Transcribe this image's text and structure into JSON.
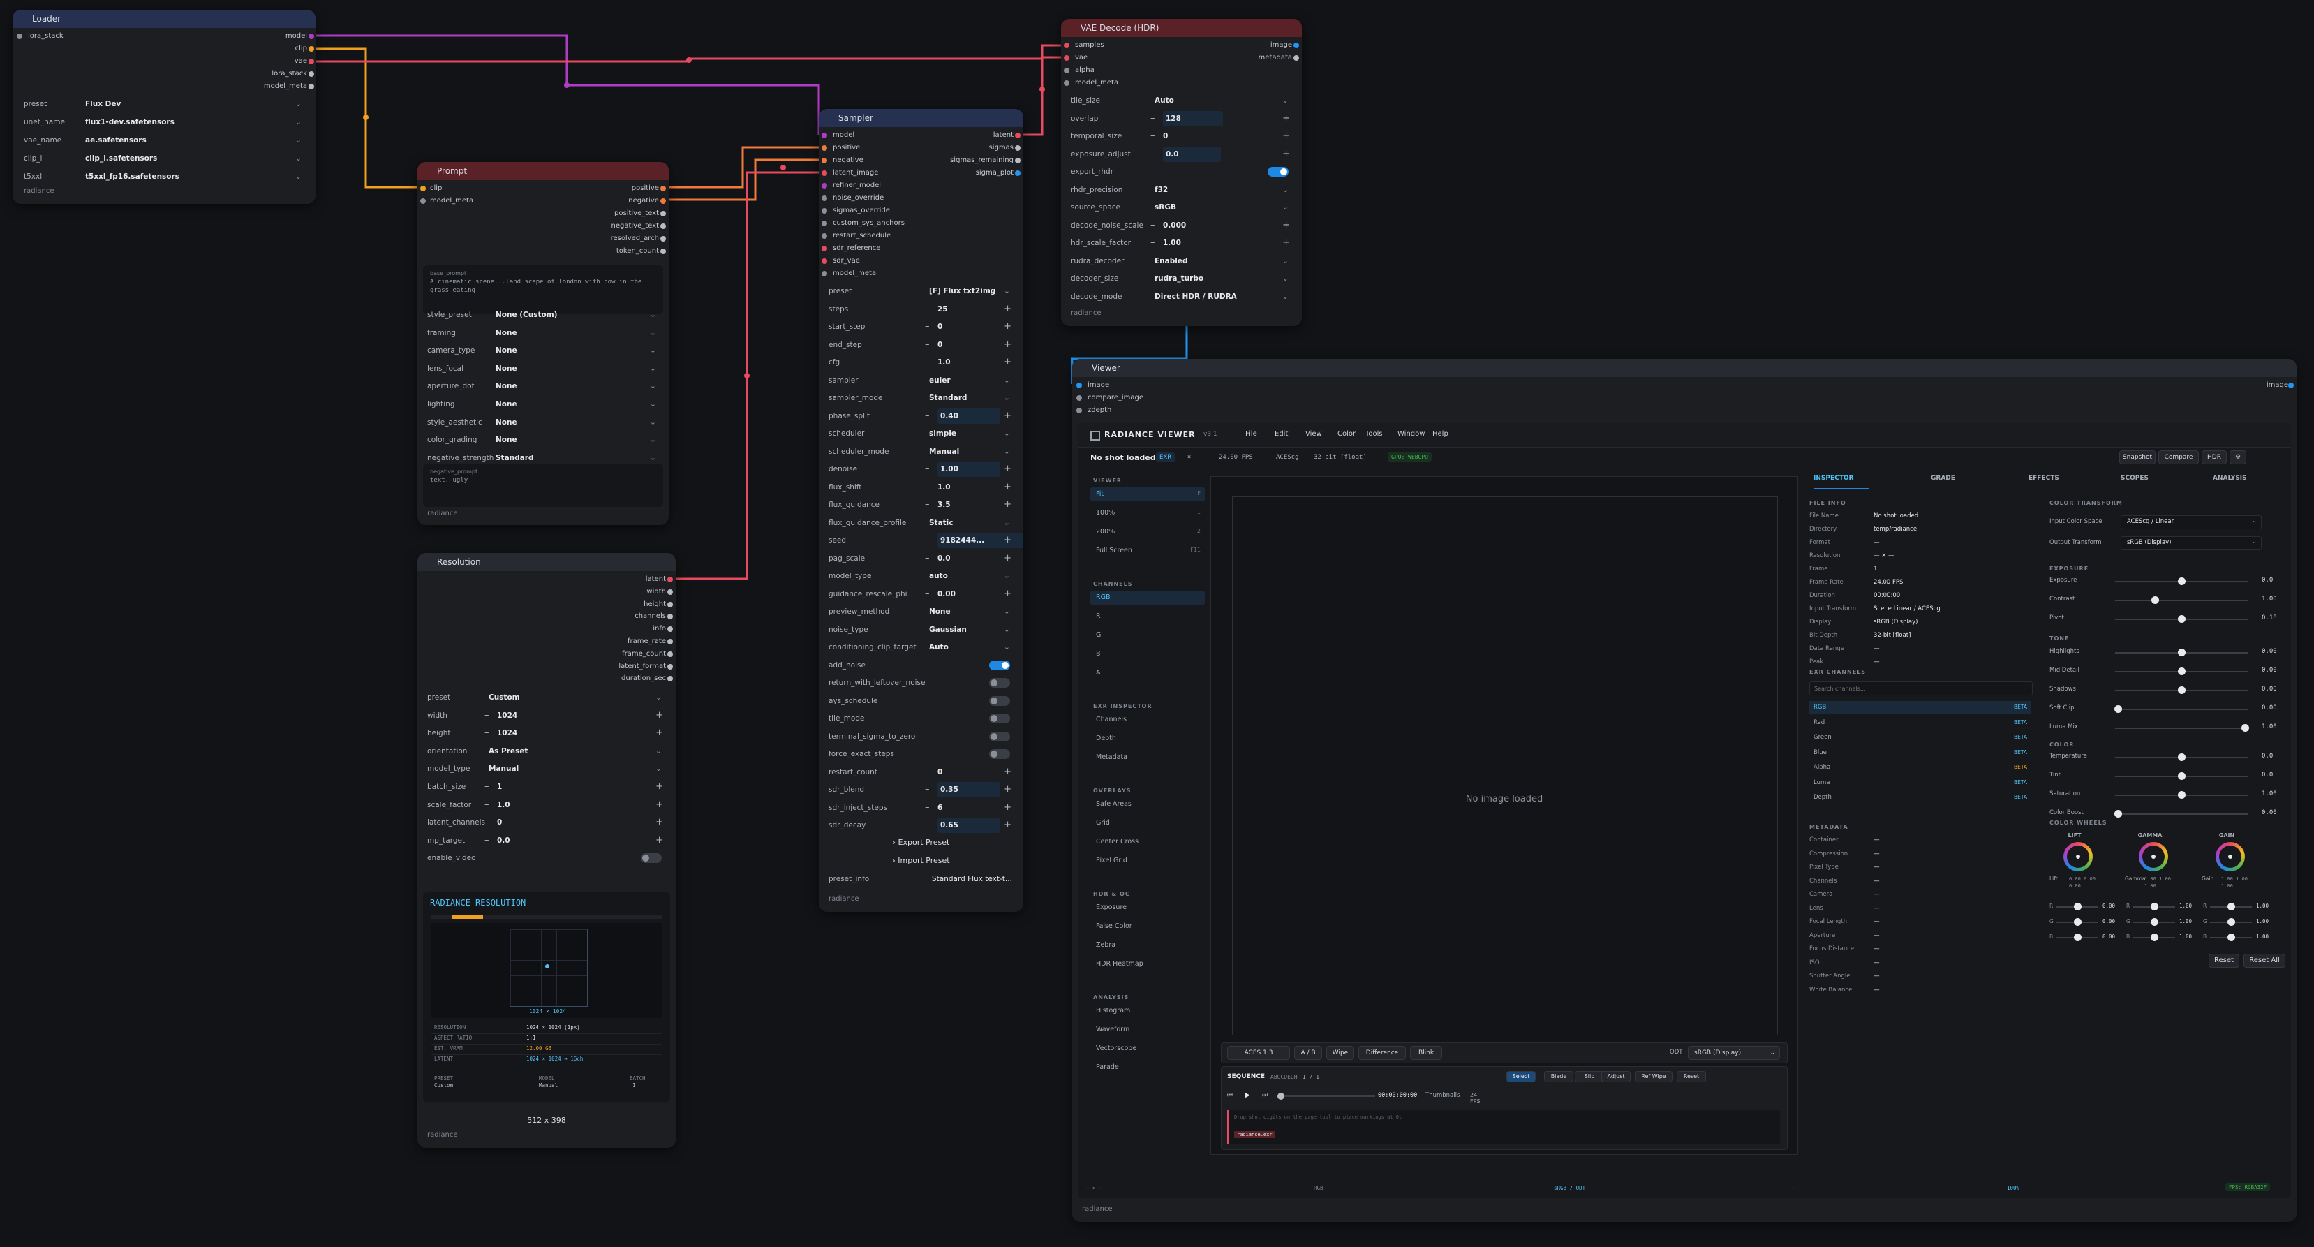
{
  "colors": {
    "accent": "#1e88e5",
    "wire_model": "#b03cc6",
    "wire_clip": "#f0a020",
    "wire_vae": "#e84a5f",
    "wire_image": "#2196f3"
  },
  "loader": {
    "title": "Loader",
    "inputs": [
      "lora_stack"
    ],
    "outputs": [
      "model",
      "clip",
      "vae",
      "lora_stack",
      "model_meta"
    ],
    "widgets": [
      {
        "label": "preset",
        "value": "Flux Dev"
      },
      {
        "label": "unet_name",
        "value": "flux1-dev.safetensors"
      },
      {
        "label": "vae_name",
        "value": "ae.safetensors"
      },
      {
        "label": "clip_l",
        "value": "clip_l.safetensors"
      },
      {
        "label": "t5xxl",
        "value": "t5xxl_fp16.safetensors"
      }
    ],
    "footer": "radiance"
  },
  "prompt": {
    "title": "Prompt",
    "inputs": [
      "clip",
      "model_meta"
    ],
    "outputs": [
      "positive",
      "negative",
      "positive_text",
      "negative_text",
      "resolved_arch",
      "token_count"
    ],
    "base_prompt_label": "base_prompt",
    "base_prompt_text": "A cinematic scene...land scape of london with cow in the grass eating",
    "widgets": [
      {
        "label": "style_preset",
        "value": "None (Custom)"
      },
      {
        "label": "framing",
        "value": "None"
      },
      {
        "label": "camera_type",
        "value": "None"
      },
      {
        "label": "lens_focal",
        "value": "None"
      },
      {
        "label": "aperture_dof",
        "value": "None"
      },
      {
        "label": "lighting",
        "value": "None"
      },
      {
        "label": "style_aesthetic",
        "value": "None"
      },
      {
        "label": "color_grading",
        "value": "None"
      },
      {
        "label": "negative_strength",
        "value": "Standard"
      }
    ],
    "negative_prompt_label": "negative_prompt",
    "negative_prompt_text": "text, ugly",
    "footer": "radiance"
  },
  "resolution": {
    "title": "Resolution",
    "outputs": [
      "latent",
      "width",
      "height",
      "channels",
      "info",
      "frame_rate",
      "frame_count",
      "latent_format",
      "duration_sec"
    ],
    "widgets": [
      {
        "label": "preset",
        "value": "Custom",
        "kind": "select"
      },
      {
        "label": "width",
        "value": "1024",
        "kind": "num"
      },
      {
        "label": "height",
        "value": "1024",
        "kind": "num"
      },
      {
        "label": "orientation",
        "value": "As Preset",
        "kind": "select"
      },
      {
        "label": "model_type",
        "value": "Manual",
        "kind": "select"
      },
      {
        "label": "batch_size",
        "value": "1",
        "kind": "num"
      },
      {
        "label": "scale_factor",
        "value": "1.0",
        "kind": "num"
      },
      {
        "label": "latent_channels",
        "value": "0",
        "kind": "num"
      },
      {
        "label": "mp_target",
        "value": "0.0",
        "kind": "num"
      },
      {
        "label": "enable_video",
        "value": "",
        "kind": "toggle"
      }
    ],
    "preview": {
      "title": "RADIANCE RESOLUTION",
      "grid_label": "1024 × 1024",
      "stats": [
        {
          "k": "RESOLUTION",
          "v": "1024 × 1024 (1px)"
        },
        {
          "k": "ASPECT RATIO",
          "v": "1:1"
        },
        {
          "k": "EST. VRAM",
          "v": "12.00 GB"
        },
        {
          "k": "LATENT",
          "v": "1024 × 1024 → 16ch"
        }
      ],
      "preset_label": "PRESET",
      "preset_value": "Custom",
      "model_label": "MODEL",
      "model_value": "Manual",
      "batch_label": "BATCH",
      "batch_value": "1",
      "size": "512 x 398"
    },
    "footer": "radiance"
  },
  "sampler": {
    "title": "Sampler",
    "inputs": [
      "model",
      "positive",
      "negative",
      "latent_image",
      "refiner_model",
      "noise_override",
      "sigmas_override",
      "custom_sys_anchors",
      "restart_schedule",
      "sdr_reference",
      "sdr_vae",
      "model_meta"
    ],
    "outputs": [
      "latent",
      "sigmas",
      "sigmas_remaining",
      "sigma_plot"
    ],
    "widgets": [
      {
        "label": "preset",
        "value": "[F] Flux txt2img",
        "kind": "select"
      },
      {
        "label": "steps",
        "value": "25",
        "kind": "num"
      },
      {
        "label": "start_step",
        "value": "0",
        "kind": "num"
      },
      {
        "label": "end_step",
        "value": "0",
        "kind": "num"
      },
      {
        "label": "cfg",
        "value": "1.0",
        "kind": "num"
      },
      {
        "label": "sampler",
        "value": "euler",
        "kind": "select"
      },
      {
        "label": "sampler_mode",
        "value": "Standard",
        "kind": "select"
      },
      {
        "label": "phase_split",
        "value": "0.40",
        "kind": "num",
        "hl": true
      },
      {
        "label": "scheduler",
        "value": "simple",
        "kind": "select"
      },
      {
        "label": "scheduler_mode",
        "value": "Manual",
        "kind": "select"
      },
      {
        "label": "denoise",
        "value": "1.00",
        "kind": "num",
        "hl": true
      },
      {
        "label": "flux_shift",
        "value": "1.0",
        "kind": "num"
      },
      {
        "label": "flux_guidance",
        "value": "3.5",
        "kind": "num"
      },
      {
        "label": "flux_guidance_profile",
        "value": "Static",
        "kind": "select"
      },
      {
        "label": "seed",
        "value": "9182444...",
        "kind": "num",
        "hl": true
      },
      {
        "label": "pag_scale",
        "value": "0.0",
        "kind": "num"
      },
      {
        "label": "model_type",
        "value": "auto",
        "kind": "select"
      },
      {
        "label": "guidance_rescale_phi",
        "value": "0.00",
        "kind": "num"
      },
      {
        "label": "preview_method",
        "value": "None",
        "kind": "select"
      },
      {
        "label": "noise_type",
        "value": "Gaussian",
        "kind": "select"
      },
      {
        "label": "conditioning_clip_target",
        "value": "Auto",
        "kind": "select"
      },
      {
        "label": "add_noise",
        "value": "",
        "kind": "toggle_on"
      },
      {
        "label": "return_with_leftover_noise",
        "value": "",
        "kind": "toggle"
      },
      {
        "label": "ays_schedule",
        "value": "",
        "kind": "toggle"
      },
      {
        "label": "tile_mode",
        "value": "",
        "kind": "toggle"
      },
      {
        "label": "terminal_sigma_to_zero",
        "value": "",
        "kind": "toggle"
      },
      {
        "label": "force_exact_steps",
        "value": "",
        "kind": "toggle"
      },
      {
        "label": "restart_count",
        "value": "0",
        "kind": "num"
      },
      {
        "label": "sdr_blend",
        "value": "0.35",
        "kind": "num",
        "hl": true
      },
      {
        "label": "sdr_inject_steps",
        "value": "6",
        "kind": "num"
      },
      {
        "label": "sdr_decay",
        "value": "0.65",
        "kind": "num",
        "hl": true
      }
    ],
    "export_preset": "› Export Preset",
    "import_preset": "› Import Preset",
    "preset_info_label": "preset_info",
    "preset_info_value": "Standard Flux text-t...",
    "footer": "radiance"
  },
  "vae": {
    "title": "VAE Decode (HDR)",
    "inputs": [
      "samples",
      "vae",
      "alpha",
      "model_meta"
    ],
    "outputs": [
      "image",
      "metadata"
    ],
    "widgets": [
      {
        "label": "tile_size",
        "value": "Auto",
        "kind": "select"
      },
      {
        "label": "overlap",
        "value": "128",
        "kind": "num",
        "hl": true
      },
      {
        "label": "temporal_size",
        "value": "0",
        "kind": "num"
      },
      {
        "label": "exposure_adjust",
        "value": "0.0",
        "kind": "num",
        "hl": true
      },
      {
        "label": "export_rhdr",
        "value": "",
        "kind": "toggle_on"
      },
      {
        "label": "rhdr_precision",
        "value": "f32",
        "kind": "select"
      },
      {
        "label": "source_space",
        "value": "sRGB",
        "kind": "select"
      },
      {
        "label": "decode_noise_scale",
        "value": "0.000",
        "kind": "num"
      },
      {
        "label": "hdr_scale_factor",
        "value": "1.00",
        "kind": "num"
      },
      {
        "label": "rudra_decoder",
        "value": "Enabled",
        "kind": "select"
      },
      {
        "label": "decoder_size",
        "value": "rudra_turbo",
        "kind": "select"
      },
      {
        "label": "decode_mode",
        "value": "Direct HDR / RUDRA",
        "kind": "select"
      }
    ],
    "footer": "radiance"
  },
  "viewer": {
    "title": "Viewer",
    "inputs": [
      "image",
      "compare_image",
      "zdepth"
    ],
    "output": "image",
    "footer": "radiance",
    "app": {
      "name": "RADIANCE VIEWER",
      "version": "v3.1",
      "menu": [
        "File",
        "Edit",
        "View",
        "Color",
        "Tools",
        "Window",
        "Help"
      ],
      "shot": "No shot loaded",
      "exr_badge": "EXR",
      "dims": "— × —",
      "fps": "24.00 FPS",
      "cs": "ACEScg",
      "bits": "32-bit [float]",
      "gpu": "GPU: WEBGPU",
      "top_buttons": [
        "Snapshot",
        "Compare",
        "HDR",
        "⚙"
      ],
      "sidebar": [
        {
          "head": "VIEWER",
          "items": [
            "Fit",
            "100%",
            "200%",
            "Full Screen"
          ]
        },
        {
          "head": "CHANNELS",
          "items": [
            "RGB",
            "R",
            "G",
            "B",
            "A"
          ]
        },
        {
          "head": "EXR INSPECTOR",
          "items": [
            "Channels",
            "Depth",
            "Metadata"
          ]
        },
        {
          "head": "OVERLAYS",
          "items": [
            "Safe Areas",
            "Grid",
            "Center Cross",
            "Pixel Grid"
          ]
        },
        {
          "head": "HDR & QC",
          "items": [
            "Exposure",
            "False Color",
            "Zebra",
            "HDR Heatmap"
          ]
        },
        {
          "head": "ANALYSIS",
          "items": [
            "Histogram",
            "Waveform",
            "Vectorscope",
            "Parade"
          ]
        }
      ],
      "sidebar_keys": [
        "F",
        "1",
        "2",
        "F11"
      ],
      "no_image": "No image loaded",
      "compare_controls": [
        "ACES 1.3",
        "A / B",
        "Wipe",
        "Difference",
        "Blink"
      ],
      "odt_label": "ODT",
      "odt_value": "sRGB (Display)",
      "sequence_label": "SEQUENCE",
      "sequence_sub": "ABOCDEGH",
      "sequence_count": "1 / 1",
      "seq_tools": [
        "Select",
        "Blade",
        "Slip",
        "Adjust",
        "Ref Wipe",
        "Reset"
      ],
      "timecode": "00:00:00:00",
      "thumbnails": "Thumbnails",
      "fps_small": "24 FPS",
      "drop_hint": "Drop shot digits on the page tool to place markings at 0t",
      "track_label": "radiance.exr",
      "tabs": [
        "INSPECTOR",
        "GRADE",
        "EFFECTS",
        "SCOPES",
        "ANALYSIS"
      ],
      "file_info_head": "FILE INFO",
      "file_info": [
        {
          "k": "File Name",
          "v": "No shot loaded"
        },
        {
          "k": "Directory",
          "v": "temp/radiance"
        },
        {
          "k": "Format",
          "v": "—"
        },
        {
          "k": "Resolution",
          "v": "— × —"
        },
        {
          "k": "Frame",
          "v": "1"
        },
        {
          "k": "Frame Rate",
          "v": "24.00 FPS"
        },
        {
          "k": "Duration",
          "v": "00:00:00"
        },
        {
          "k": "Input Transform",
          "v": "Scene Linear / ACEScg"
        },
        {
          "k": "Display",
          "v": "sRGB (Display)"
        },
        {
          "k": "Bit Depth",
          "v": "32-bit [float]"
        },
        {
          "k": "Data Range",
          "v": "—"
        },
        {
          "k": "Peak",
          "v": "—"
        }
      ],
      "exr_channels_head": "EXR CHANNELS",
      "search_placeholder": "Search channels...",
      "channels": [
        {
          "name": "RGB",
          "tag": "BETA"
        },
        {
          "name": "Red",
          "tag": "BETA"
        },
        {
          "name": "Green",
          "tag": "BETA"
        },
        {
          "name": "Blue",
          "tag": "BETA"
        },
        {
          "name": "Alpha",
          "tag": "BETA"
        },
        {
          "name": "Luma",
          "tag": "BETA"
        },
        {
          "name": "Depth",
          "tag": "BETA"
        }
      ],
      "metadata_head": "METADATA",
      "metadata": [
        "Container",
        "Compression",
        "Pixel Type",
        "Channels",
        "Camera",
        "Lens",
        "Focal Length",
        "Aperture",
        "Focus Distance",
        "ISO",
        "Shutter Angle",
        "White Balance"
      ],
      "metadata_value": "—",
      "color_transform_head": "COLOR TRANSFORM",
      "input_cs_label": "Input Color Space",
      "input_cs_value": "ACEScg / Linear",
      "output_tf_label": "Output Transform",
      "output_tf_value": "sRGB (Display)",
      "exposure_head": "EXPOSURE",
      "exposure": [
        {
          "k": "Exposure",
          "v": "0.0",
          "pos": 0.5
        },
        {
          "k": "Contrast",
          "v": "1.00",
          "pos": 0.3
        },
        {
          "k": "Pivot",
          "v": "0.18",
          "pos": 0.5
        }
      ],
      "tone_head": "TONE",
      "tone": [
        {
          "k": "Highlights",
          "v": "0.00",
          "pos": 0.5
        },
        {
          "k": "Mid Detail",
          "v": "0.00",
          "pos": 0.5
        },
        {
          "k": "Shadows",
          "v": "0.00",
          "pos": 0.5
        },
        {
          "k": "Soft Clip",
          "v": "0.00",
          "pos": 0.02
        },
        {
          "k": "Luma Mix",
          "v": "1.00",
          "pos": 0.98
        }
      ],
      "color_head": "COLOR",
      "color": [
        {
          "k": "Temperature",
          "v": "0.0",
          "pos": 0.5
        },
        {
          "k": "Tint",
          "v": "0.0",
          "pos": 0.5
        },
        {
          "k": "Saturation",
          "v": "1.00",
          "pos": 0.5
        },
        {
          "k": "Color Boost",
          "v": "0.00",
          "pos": 0.02
        }
      ],
      "wheels_head": "COLOR WHEELS",
      "wheels": [
        {
          "name": "LIFT",
          "sub": "Lift",
          "vals": "0.00 0.00 0.00"
        },
        {
          "name": "GAMMA",
          "sub": "Gamma",
          "vals": "1.00 1.00 1.00"
        },
        {
          "name": "GAIN",
          "sub": "Gain",
          "vals": "1.00 1.00 1.00"
        }
      ],
      "wheel_sliders": [
        {
          "ch": "R",
          "v": [
            "0.00",
            "1.00",
            "1.00"
          ]
        },
        {
          "ch": "G",
          "v": [
            "0.00",
            "1.00",
            "1.00"
          ]
        },
        {
          "ch": "B",
          "v": [
            "0.00",
            "1.00",
            "1.00"
          ]
        }
      ],
      "reset": "Reset",
      "reset_all": "Reset All",
      "status": {
        "left": "— × —",
        "mid1": "RGB",
        "mid2": "sRGB / ODT",
        "mid3": "—",
        "zoom": "100%",
        "right": "FPS: RGBA32F"
      }
    }
  }
}
